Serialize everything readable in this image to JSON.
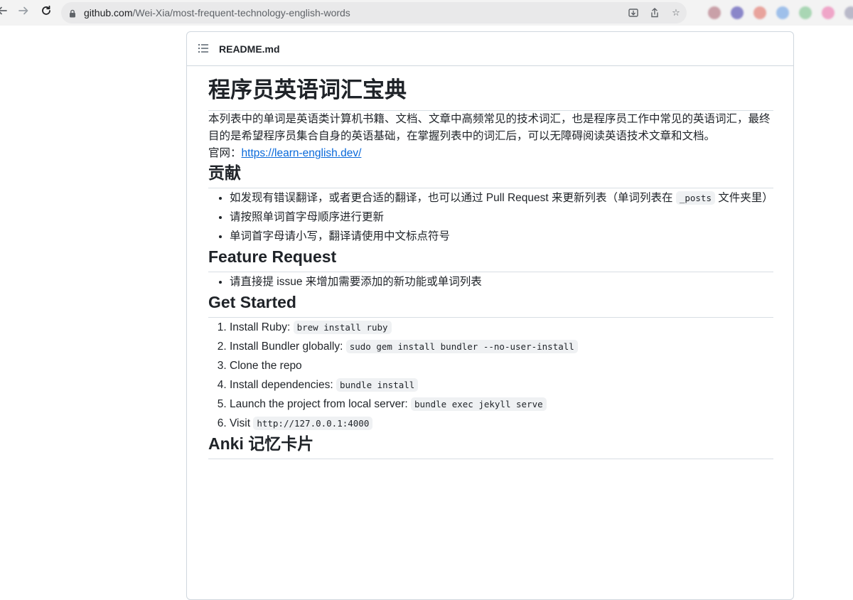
{
  "browser": {
    "url_host": "github.com",
    "url_path": "/Wei-Xia/most-frequent-technology-english-words",
    "extension_colors": [
      "#c9a0a8",
      "#8a86c9",
      "#e8a39c",
      "#9fc0ea",
      "#a9d6b4",
      "#efa5c8",
      "#b9b9c9"
    ]
  },
  "readme": {
    "filename": "README.md",
    "title": "程序员英语词汇宝典",
    "intro": "本列表中的单词是英语类计算机书籍、文档、文章中高频常见的技术词汇，也是程序员工作中常见的英语词汇，最终目的是希望程序员集合自身的英语基础，在掌握列表中的词汇后，可以无障碍阅读英语技术文章和文档。",
    "site_label": "官网：",
    "site_link": "https://learn-english.dev/",
    "contribute": {
      "heading": "贡献",
      "item1_prefix": "如发现有错误翻译，或者更合适的翻译，也可以通过 Pull Request 来更新列表（单词列表在 ",
      "item1_code": "_posts",
      "item1_suffix": " 文件夹里）",
      "item2": "请按照单词首字母顺序进行更新",
      "item3": "单词首字母请小写，翻译请使用中文标点符号"
    },
    "feature": {
      "heading": "Feature Request",
      "item1": "请直接提 issue 来增加需要添加的新功能或单词列表"
    },
    "get_started": {
      "heading": "Get Started",
      "steps": [
        {
          "text": "Install Ruby: ",
          "code": "brew install ruby"
        },
        {
          "text": "Install Bundler globally: ",
          "code": "sudo gem install bundler --no-user-install"
        },
        {
          "text": "Clone the repo",
          "code": ""
        },
        {
          "text": "Install dependencies: ",
          "code": "bundle install"
        },
        {
          "text": "Launch the project from local server: ",
          "code": "bundle exec jekyll serve"
        },
        {
          "text": "Visit ",
          "code": "http://127.0.0.1:4000"
        }
      ]
    },
    "anki": {
      "heading": "Anki 记忆卡片"
    }
  }
}
